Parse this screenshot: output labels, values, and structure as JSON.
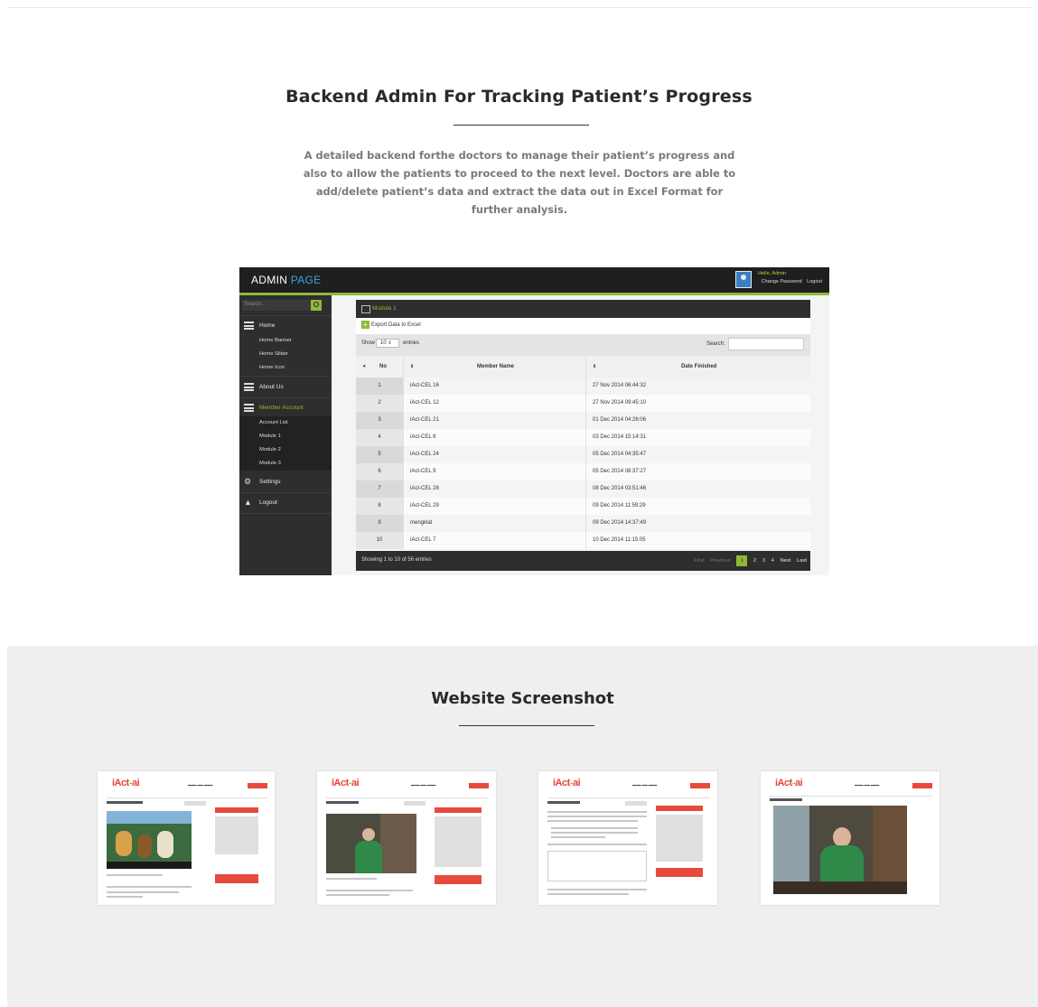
{
  "backend_section": {
    "title": "Backend Admin For Tracking Patient’s Progress",
    "description": "A detailed backend forthe doctors to manage their patient’s progress and also to allow the patients to proceed to the next level. Doctors are able to add/delete patient’s  data and extract the data out in Excel Format for further analysis."
  },
  "admin": {
    "logo_main": "ADMIN",
    "logo_accent": "PAGE",
    "greeting": "Hello, Admin",
    "change_password": "Change Password",
    "logout_link": "Logout",
    "search_placeholder": "Search...",
    "nav": {
      "home": "Home",
      "home_banner": "Home Banner",
      "home_slider": "Home Slider",
      "home_icon": "Home Icon",
      "about_us": "About Us",
      "member_account": "Member Account",
      "account_list": "Account List",
      "module1": "Module 1",
      "module2": "Module 2",
      "module3": "Module 3",
      "settings": "Settings",
      "logout": "Logout"
    },
    "module_title": "Module 1",
    "export_label": "Export Data to Excel",
    "show_label": "Show",
    "show_value": "10",
    "entries_label": "entries",
    "search_label": "Search:",
    "columns": {
      "no": "No",
      "name": "Member Name",
      "date": "Date Finished"
    },
    "rows": [
      {
        "no": "1",
        "name": "iAct-CEL 16",
        "date": "27 Nov 2014 06:44:32"
      },
      {
        "no": "2",
        "name": "iAct-CEL 12",
        "date": "27 Nov 2014 09:45:10"
      },
      {
        "no": "3",
        "name": "iAct-CEL 21",
        "date": "01 Dec 2014 04:26:06"
      },
      {
        "no": "4",
        "name": "iAct-CEL 8",
        "date": "03 Dec 2014 15:14:31"
      },
      {
        "no": "5",
        "name": "iAct-CEL 24",
        "date": "05 Dec 2014 04:35:47"
      },
      {
        "no": "6",
        "name": "iAct-CEL 9",
        "date": "05 Dec 2014 08:37:27"
      },
      {
        "no": "7",
        "name": "iAct-CEL 28",
        "date": "08 Dec 2014 03:51:46"
      },
      {
        "no": "8",
        "name": "iAct-CEL 29",
        "date": "09 Dec 2014 11:59:29"
      },
      {
        "no": "9",
        "name": "mengklat",
        "date": "09 Dec 2014 14:37:49"
      },
      {
        "no": "10",
        "name": "iAct-CEL 7",
        "date": "10 Dec 2014 11:15:05"
      }
    ],
    "footer_info": "Showing 1 to 10 of 56 entries",
    "pager": {
      "first": "First",
      "previous": "Previous",
      "pages": [
        "1",
        "2",
        "3",
        "4"
      ],
      "next": "Next",
      "last": "Last"
    }
  },
  "screenshots_section": {
    "title": "Website Screenshot"
  },
  "colors": {
    "accent_green": "#8fb93a",
    "accent_blue": "#35a8d6",
    "brand_red": "#e8493c"
  }
}
